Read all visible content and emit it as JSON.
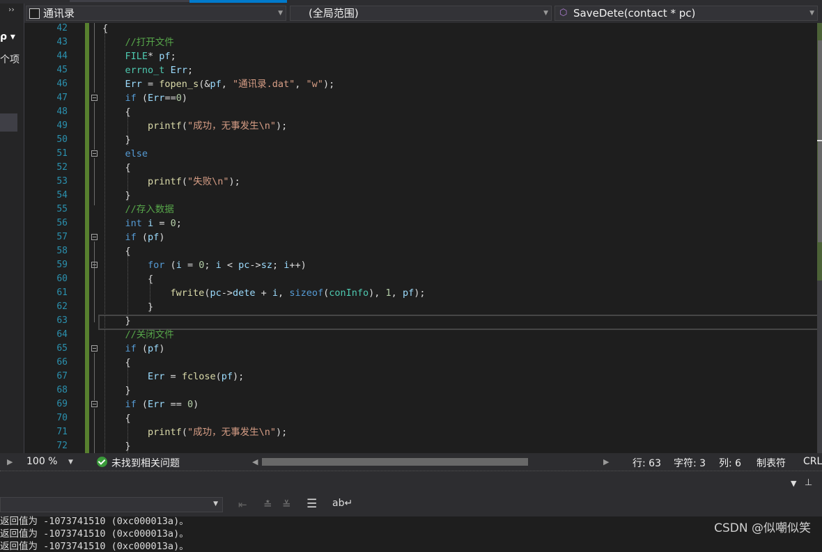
{
  "navbar": {
    "project": "通讯录",
    "scope": "(全局范围)",
    "member": "SaveDete(contact * pc)"
  },
  "left_panel": {
    "fragment": "个项"
  },
  "code_lines": [
    {
      "n": "42",
      "html": "{"
    },
    {
      "n": "43",
      "html": "    <span class='cm'>//打开文件</span>"
    },
    {
      "n": "44",
      "html": "    <span class='ty'>FILE</span>* <span class='pr'>pf</span>;"
    },
    {
      "n": "45",
      "html": "    <span class='ty'>errno_t</span> <span class='pr'>Err</span>;"
    },
    {
      "n": "46",
      "html": "    <span class='pr'>Err</span> = <span class='fn'>fopen_s</span>(&amp;<span class='pr'>pf</span>, <span class='st'>\"通讯录.dat\"</span>, <span class='st'>\"w\"</span>);"
    },
    {
      "n": "47",
      "html": "    <span class='kw'>if</span> (<span class='pr'>Err</span>==<span class='nu'>0</span>)"
    },
    {
      "n": "48",
      "html": "    {"
    },
    {
      "n": "49",
      "html": "        <span class='fn'>printf</span>(<span class='st'>\"成功，无事发生\\n\"</span>);"
    },
    {
      "n": "50",
      "html": "    }"
    },
    {
      "n": "51",
      "html": "    <span class='kw'>else</span>"
    },
    {
      "n": "52",
      "html": "    {"
    },
    {
      "n": "53",
      "html": "        <span class='fn'>printf</span>(<span class='st'>\"失败\\n\"</span>);"
    },
    {
      "n": "54",
      "html": "    }"
    },
    {
      "n": "55",
      "html": "    <span class='cm'>//存入数据</span>"
    },
    {
      "n": "56",
      "html": "    <span class='kw'>int</span> <span class='pr'>i</span> = <span class='nu'>0</span>;"
    },
    {
      "n": "57",
      "html": "    <span class='kw'>if</span> (<span class='pr'>pf</span>)"
    },
    {
      "n": "58",
      "html": "    {"
    },
    {
      "n": "59",
      "html": "        <span class='kw'>for</span> (<span class='pr'>i</span> = <span class='nu'>0</span>; <span class='pr'>i</span> &lt; <span class='pr'>pc</span>-&gt;<span class='pr'>sz</span>; <span class='pr'>i</span>++)"
    },
    {
      "n": "60",
      "html": "        {"
    },
    {
      "n": "61",
      "html": "            <span class='fn'>fwrite</span>(<span class='pr'>pc</span>-&gt;<span class='pr'>dete</span> + <span class='pr'>i</span>, <span class='kw'>sizeof</span>(<span class='ty'>conInfo</span>), <span class='nu'>1</span>, <span class='pr'>pf</span>);"
    },
    {
      "n": "62",
      "html": "        }"
    },
    {
      "n": "63",
      "html": "    }"
    },
    {
      "n": "64",
      "html": "    <span class='cm'>//关闭文件</span>"
    },
    {
      "n": "65",
      "html": "    <span class='kw'>if</span> (<span class='pr'>pf</span>)"
    },
    {
      "n": "66",
      "html": "    {"
    },
    {
      "n": "67",
      "html": "        <span class='pr'>Err</span> = <span class='fn'>fclose</span>(<span class='pr'>pf</span>);"
    },
    {
      "n": "68",
      "html": "    }"
    },
    {
      "n": "69",
      "html": "    <span class='kw'>if</span> (<span class='pr'>Err</span> == <span class='nu'>0</span>)"
    },
    {
      "n": "70",
      "html": "    {"
    },
    {
      "n": "71",
      "html": "        <span class='fn'>printf</span>(<span class='st'>\"成功，无事发生\\n\"</span>);"
    },
    {
      "n": "72",
      "html": "    }"
    }
  ],
  "status": {
    "zoom": "100 %",
    "issues": "未找到相关问题",
    "line": "行: 63",
    "char": "字符: 3",
    "col": "列: 6",
    "tabs": "制表符",
    "eol": "CRLF"
  },
  "output": {
    "line1": "返回值为 -1073741510 (0xc000013a)。",
    "line2": "返回值为 -1073741510 (0xc000013a)。",
    "line3": "返回值为 -1073741510 (0xc000013a)。"
  },
  "watermark": "CSDN @似嘲似笑",
  "colors": {
    "accent": "#007acc",
    "change_margin": "#58802f",
    "ok": "#3a9a3a"
  }
}
